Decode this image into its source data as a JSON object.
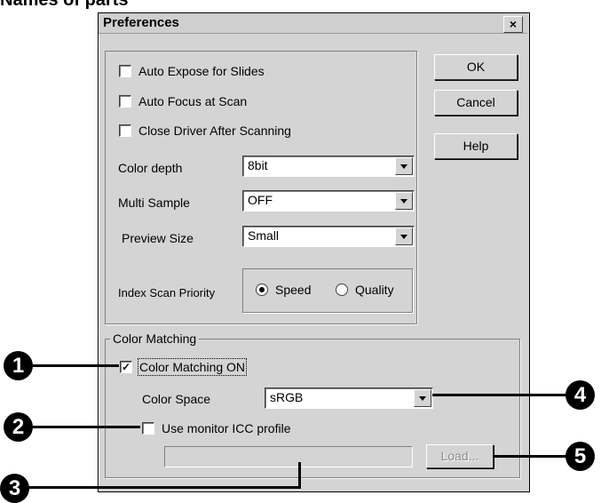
{
  "page_heading": "Names of parts",
  "dialog": {
    "title": "Preferences",
    "close_glyph": "×",
    "options": {
      "auto_expose": {
        "label": "Auto Expose for Slides",
        "checked": false
      },
      "auto_focus": {
        "label": "Auto Focus at Scan",
        "checked": false
      },
      "close_driver": {
        "label": "Close Driver After Scanning",
        "checked": false
      },
      "color_depth": {
        "label": "Color depth",
        "value": "8bit"
      },
      "multi_sample": {
        "label": "Multi Sample",
        "value": "OFF"
      },
      "preview_size": {
        "label": "Preview Size",
        "value": "Small"
      },
      "index_scan": {
        "label": "Index Scan Priority",
        "speed_label": "Speed",
        "quality_label": "Quality",
        "selected": "Speed"
      }
    },
    "color_matching": {
      "group_label": "Color Matching",
      "enabled_label": "Color Matching ON",
      "enabled_glyph": "✓",
      "color_space_label": "Color Space",
      "color_space_value": "sRGB",
      "monitor_icc_label": "Use monitor ICC profile",
      "profile_path_value": ""
    },
    "buttons": {
      "ok": "OK",
      "cancel": "Cancel",
      "help": "Help",
      "load": "Load..."
    }
  },
  "callouts": [
    "1",
    "2",
    "3",
    "4",
    "5"
  ],
  "colors": {
    "dialog_face": "#d4d4d4",
    "disabled_text": "#8a8a8a"
  }
}
